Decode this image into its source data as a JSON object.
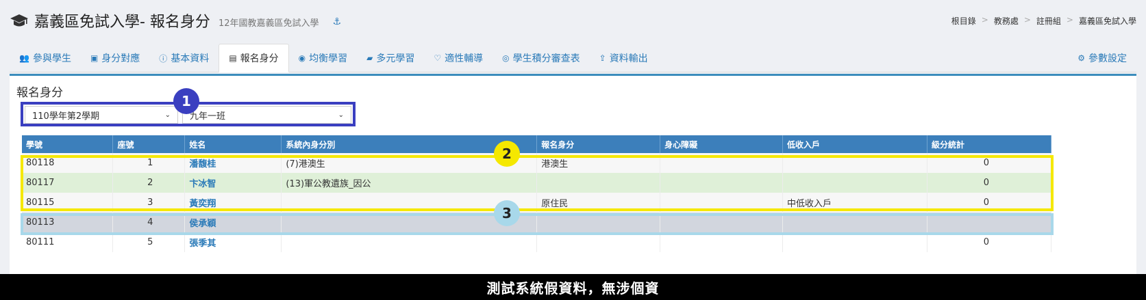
{
  "header": {
    "title": "嘉義區免試入學- 報名身分",
    "subtitle": "12年國教嘉義區免試入學",
    "anchor_icon": "anchor-icon"
  },
  "breadcrumb": [
    "根目錄",
    "教務處",
    "註冊組",
    "嘉義區免試入學"
  ],
  "breadcrumb_sep": ">",
  "tabs": [
    {
      "label": "參與學生",
      "icon": "users-plus-icon",
      "glyph": "👥"
    },
    {
      "label": "身分對應",
      "icon": "id-doc-icon",
      "glyph": "▣"
    },
    {
      "label": "基本資料",
      "icon": "info-circle-icon",
      "glyph": "ⓘ"
    },
    {
      "label": "報名身分",
      "icon": "id-card-icon",
      "glyph": "▤",
      "active": true
    },
    {
      "label": "均衡學習",
      "icon": "balance-icon",
      "glyph": "◉"
    },
    {
      "label": "多元學習",
      "icon": "book-icon",
      "glyph": "▰"
    },
    {
      "label": "適性輔導",
      "icon": "heart-icon",
      "glyph": "♡"
    },
    {
      "label": "學生積分審查表",
      "icon": "eye-icon",
      "glyph": "◎"
    },
    {
      "label": "資料輸出",
      "icon": "upload-icon",
      "glyph": "⇪"
    }
  ],
  "settings_tab": {
    "label": "參數設定",
    "icon": "gear-icon",
    "glyph": "⚙"
  },
  "panel": {
    "title": "報名身分",
    "term_select": "110學年第2學期",
    "class_select": "九年一班"
  },
  "badges": [
    "1",
    "2",
    "3"
  ],
  "table": {
    "columns": [
      "學號",
      "座號",
      "姓名",
      "系統內身分別",
      "報名身分",
      "身心障礙",
      "低收入戶",
      "級分統計"
    ],
    "rows": [
      {
        "id": "80118",
        "seat": "1",
        "name": "潘馥桂",
        "sys_identity": "(7)港澳生",
        "apply_identity": "港澳生",
        "disability": "",
        "low_income": "",
        "total": "0"
      },
      {
        "id": "80117",
        "seat": "2",
        "name": "卞冰智",
        "sys_identity": "(13)軍公教遺族_因公",
        "apply_identity": "",
        "disability": "",
        "low_income": "",
        "total": "0"
      },
      {
        "id": "80115",
        "seat": "3",
        "name": "黃奕翔",
        "sys_identity": "",
        "apply_identity": "原住民",
        "disability": "",
        "low_income": "中低收入戶",
        "total": "0"
      },
      {
        "id": "80113",
        "seat": "4",
        "name": "侯承穎",
        "sys_identity": "",
        "apply_identity": "",
        "disability": "",
        "low_income": "",
        "total": ""
      },
      {
        "id": "80111",
        "seat": "5",
        "name": "張季其",
        "sys_identity": "",
        "apply_identity": "",
        "disability": "",
        "low_income": "",
        "total": "0"
      }
    ]
  },
  "footer": "測試系統假資料，無涉個資",
  "colors": {
    "brand": "#3c7fbb",
    "highlight_1": "#3a3fc0",
    "highlight_2": "#f5e800",
    "highlight_3": "#a8d8ea"
  }
}
